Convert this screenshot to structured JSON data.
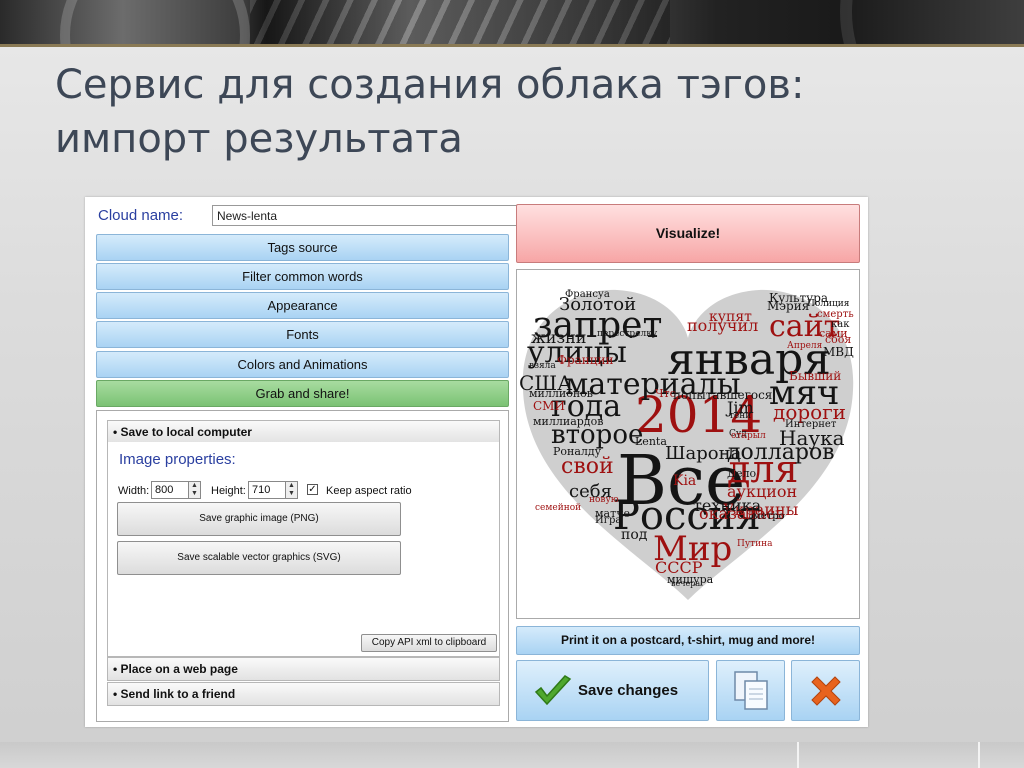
{
  "slide": {
    "title_line1": "Сервис для создания облака тэгов:",
    "title_line2": "импорт результата"
  },
  "form": {
    "cloud_name_label": "Cloud name:",
    "cloud_name_value": "News-lenta"
  },
  "accordion": [
    {
      "label": "Tags source"
    },
    {
      "label": "Filter common words"
    },
    {
      "label": "Appearance"
    },
    {
      "label": "Fonts"
    },
    {
      "label": "Colors and Animations"
    },
    {
      "label": "Grab and share!",
      "active": true
    }
  ],
  "grab": {
    "save_local": "• Save to local computer",
    "image_properties": "Image properties:",
    "width_label": "Width:",
    "width_value": "800",
    "height_label": "Height:",
    "height_value": "710",
    "keep_aspect_label": "Keep aspect ratio",
    "keep_aspect_checked": true,
    "save_png": "Save graphic image (PNG)",
    "save_svg": "Save scalable vector graphics (SVG)",
    "copy_api": "Copy API xml to clipboard",
    "place_web": "• Place on a web page",
    "send_link": "• Send link to a friend"
  },
  "right": {
    "visualize": "Visualize!",
    "print": "Print it on a postcard, t-shirt, mug and more!",
    "save_changes": "Save changes"
  },
  "icons": {
    "save_changes": "checkmark-icon",
    "copy": "copy-icon",
    "delete": "close-icon"
  },
  "colors": {
    "heart": "#cccccc",
    "word_dark": "#141414",
    "word_red": "#9e1010",
    "visualize_bg": "#f7a6a6",
    "active_green": "#7bc274",
    "accordion_blue": "#a9d3f3"
  },
  "cloud_words": [
    {
      "text": "Все",
      "color": "dark"
    },
    {
      "text": "2014",
      "color": "red"
    },
    {
      "text": "января",
      "color": "dark"
    },
    {
      "text": "Россия",
      "color": "dark"
    },
    {
      "text": "для",
      "color": "red"
    },
    {
      "text": "материалы",
      "color": "dark"
    },
    {
      "text": "запрет",
      "color": "dark"
    },
    {
      "text": "года",
      "color": "dark"
    },
    {
      "text": "сайт",
      "color": "red"
    },
    {
      "text": "мяч",
      "color": "dark"
    },
    {
      "text": "улицы",
      "color": "dark"
    },
    {
      "text": "Мир",
      "color": "red"
    },
    {
      "text": "второе",
      "color": "dark"
    },
    {
      "text": "долларов",
      "color": "dark"
    },
    {
      "text": "свой",
      "color": "red"
    },
    {
      "text": "США",
      "color": "dark"
    },
    {
      "text": "Наука",
      "color": "dark"
    },
    {
      "text": "дороги",
      "color": "red"
    },
    {
      "text": "получил",
      "color": "red"
    },
    {
      "text": "Шарона",
      "color": "dark"
    },
    {
      "text": "себя",
      "color": "dark"
    },
    {
      "text": "Украины",
      "color": "red"
    },
    {
      "text": "аукцион",
      "color": "red"
    },
    {
      "text": "техника",
      "color": "dark"
    },
    {
      "text": "оказалась",
      "color": "red"
    },
    {
      "text": "СССР",
      "color": "red"
    },
    {
      "text": "Золотой",
      "color": "dark"
    },
    {
      "text": "купят",
      "color": "red"
    },
    {
      "text": "Культура",
      "color": "dark"
    },
    {
      "text": "жизни",
      "color": "dark"
    },
    {
      "text": "миллионов",
      "color": "dark"
    },
    {
      "text": "МВД",
      "color": "dark"
    },
    {
      "text": "Бывший",
      "color": "red"
    },
    {
      "text": "Франции",
      "color": "red"
    },
    {
      "text": "Роналду",
      "color": "dark"
    },
    {
      "text": "Kia",
      "color": "red"
    },
    {
      "text": "под",
      "color": "dark"
    },
    {
      "text": "мишура",
      "color": "dark"
    },
    {
      "text": "Jim",
      "color": "dark"
    },
    {
      "text": "Lenta",
      "color": "dark"
    },
    {
      "text": "Мэрия",
      "color": "dark"
    },
    {
      "text": "Что",
      "color": "red"
    },
    {
      "text": "попытавшегося",
      "color": "dark"
    },
    {
      "text": "миллиардов",
      "color": "dark"
    },
    {
      "text": "Интернет",
      "color": "dark"
    },
    {
      "text": "матче",
      "color": "dark"
    },
    {
      "text": "Игра",
      "color": "dark"
    },
    {
      "text": "метро",
      "color": "dark"
    },
    {
      "text": "Дело",
      "color": "dark"
    },
    {
      "text": "СМИ",
      "color": "red"
    },
    {
      "text": "Франсуа",
      "color": "dark"
    },
    {
      "text": "сбоя",
      "color": "red"
    },
    {
      "text": "как",
      "color": "dark"
    },
    {
      "text": "сами",
      "color": "red"
    },
    {
      "text": "смерть",
      "color": "red"
    },
    {
      "text": "Полиция",
      "color": "dark"
    },
    {
      "text": "перестрелку",
      "color": "dark"
    },
    {
      "text": "взяла",
      "color": "dark"
    },
    {
      "text": "тени",
      "color": "dark"
    },
    {
      "text": "Суд",
      "color": "dark"
    },
    {
      "text": "открыл",
      "color": "red"
    },
    {
      "text": "новую",
      "color": "red"
    },
    {
      "text": "семейной",
      "color": "red"
    },
    {
      "text": "вечера",
      "color": "dark"
    },
    {
      "text": "Апреля",
      "color": "red"
    },
    {
      "text": "Путина",
      "color": "red"
    }
  ]
}
